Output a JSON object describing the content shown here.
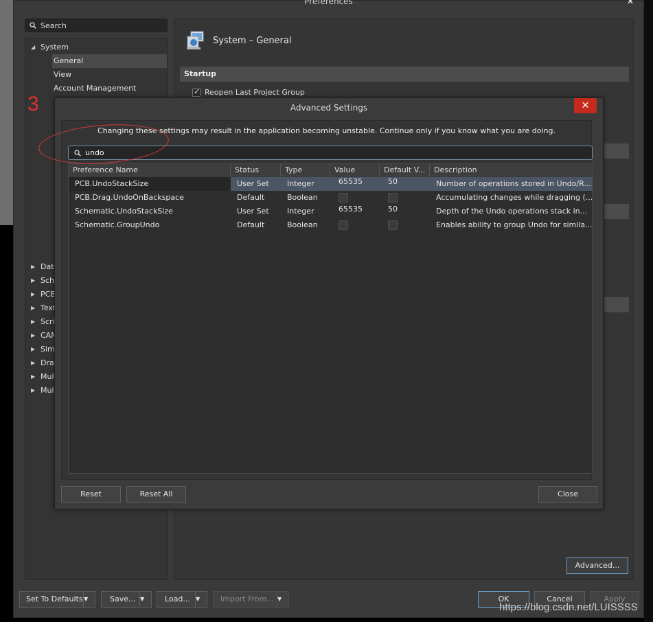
{
  "window": {
    "title": "Preferences",
    "close_glyph": "✕"
  },
  "search": {
    "label": "Search"
  },
  "nav": {
    "system": "System",
    "system_children": [
      "General",
      "View",
      "Account Management"
    ],
    "collapsed_groups": [
      "Data",
      "Sche",
      "PCB",
      "Text",
      "Scrip",
      "CAM",
      "Simu",
      "Draf",
      "Mul",
      "Mul"
    ]
  },
  "page": {
    "title": "System – General",
    "section": "Startup",
    "reopen_label": "Reopen Last Project Group",
    "advanced_button": "Advanced..."
  },
  "footer": {
    "set_defaults": "Set To Defaults",
    "save": "Save...",
    "load": "Load...",
    "import_from": "Import From...",
    "ok": "OK",
    "cancel": "Cancel",
    "apply": "Apply"
  },
  "dialog": {
    "title": "Advanced Settings",
    "close_glyph": "✕",
    "warning": "Changing these settings may result in the application becoming unstable. Continue only if you know what you are doing.",
    "search_value": "undo",
    "columns": [
      "Preference Name",
      "Status",
      "Type",
      "Value",
      "Default V...",
      "Description"
    ],
    "rows": [
      {
        "name": "PCB.UndoStackSize",
        "status": "User Set",
        "type": "Integer",
        "value": "65535",
        "default": "50",
        "description": "Number of operations stored in Undo/R..."
      },
      {
        "name": "PCB.Drag.UndoOnBackspace",
        "status": "Default",
        "type": "Boolean",
        "value": "",
        "default": "",
        "description": "Accumulating changes while dragging (..."
      },
      {
        "name": "Schematic.UndoStackSize",
        "status": "User Set",
        "type": "Integer",
        "value": "65535",
        "default": "50",
        "description": "Depth of the Undo operations stack in..."
      },
      {
        "name": "Schematic.GroupUndo",
        "status": "Default",
        "type": "Boolean",
        "value": "",
        "default": "",
        "description": "Enables ability to group Undo for simila..."
      }
    ],
    "reset": "Reset",
    "reset_all": "Reset All",
    "close": "Close"
  },
  "annotation": {
    "step_number": "3",
    "color": "#e03030"
  },
  "watermark": "https://blog.csdn.net/LUISSSS"
}
